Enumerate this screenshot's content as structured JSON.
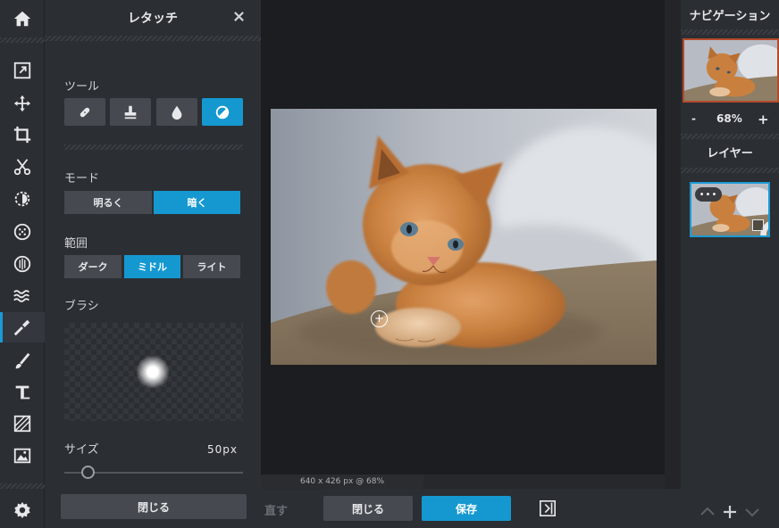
{
  "panel": {
    "title": "レタッチ",
    "tools_label": "ツール",
    "mode_label": "モード",
    "mode_options": [
      "明るく",
      "暗く"
    ],
    "mode_selected": "暗く",
    "range_label": "範囲",
    "range_options": [
      "ダーク",
      "ミドル",
      "ライト"
    ],
    "range_selected": "ミドル",
    "brush_label": "ブラシ",
    "size_label": "サイズ",
    "size_value": "50px",
    "size_fraction": 0.13,
    "close_button": "閉じる"
  },
  "tools": [
    {
      "icon": "bandage-icon"
    },
    {
      "icon": "stamp-icon"
    },
    {
      "icon": "drop-icon"
    },
    {
      "icon": "dodge-burn-icon",
      "active": true
    }
  ],
  "rail_icons": [
    "home-icon",
    "export-icon",
    "move-icon",
    "crop-icon",
    "cut-icon",
    "adjust-icon",
    "filter-icon",
    "liquify-icon",
    "wave-icon",
    "retouch-brush-icon",
    "paint-brush-icon",
    "text-icon",
    "texture-icon",
    "image-icon",
    "settings-icon"
  ],
  "canvas": {
    "status": "640 x 426 px @ 68%"
  },
  "bottom": {
    "undo": "直す",
    "cancel": "閉じる",
    "save": "保存"
  },
  "navigator": {
    "title": "ナビゲーション",
    "zoom_minus": "-",
    "zoom_value": "68%",
    "zoom_plus": "+"
  },
  "layers": {
    "title": "レイヤー",
    "menu": "•••"
  },
  "colors": {
    "accent": "#1598d0",
    "panel": "#2b2e33",
    "workspace": "#1c1d20"
  }
}
